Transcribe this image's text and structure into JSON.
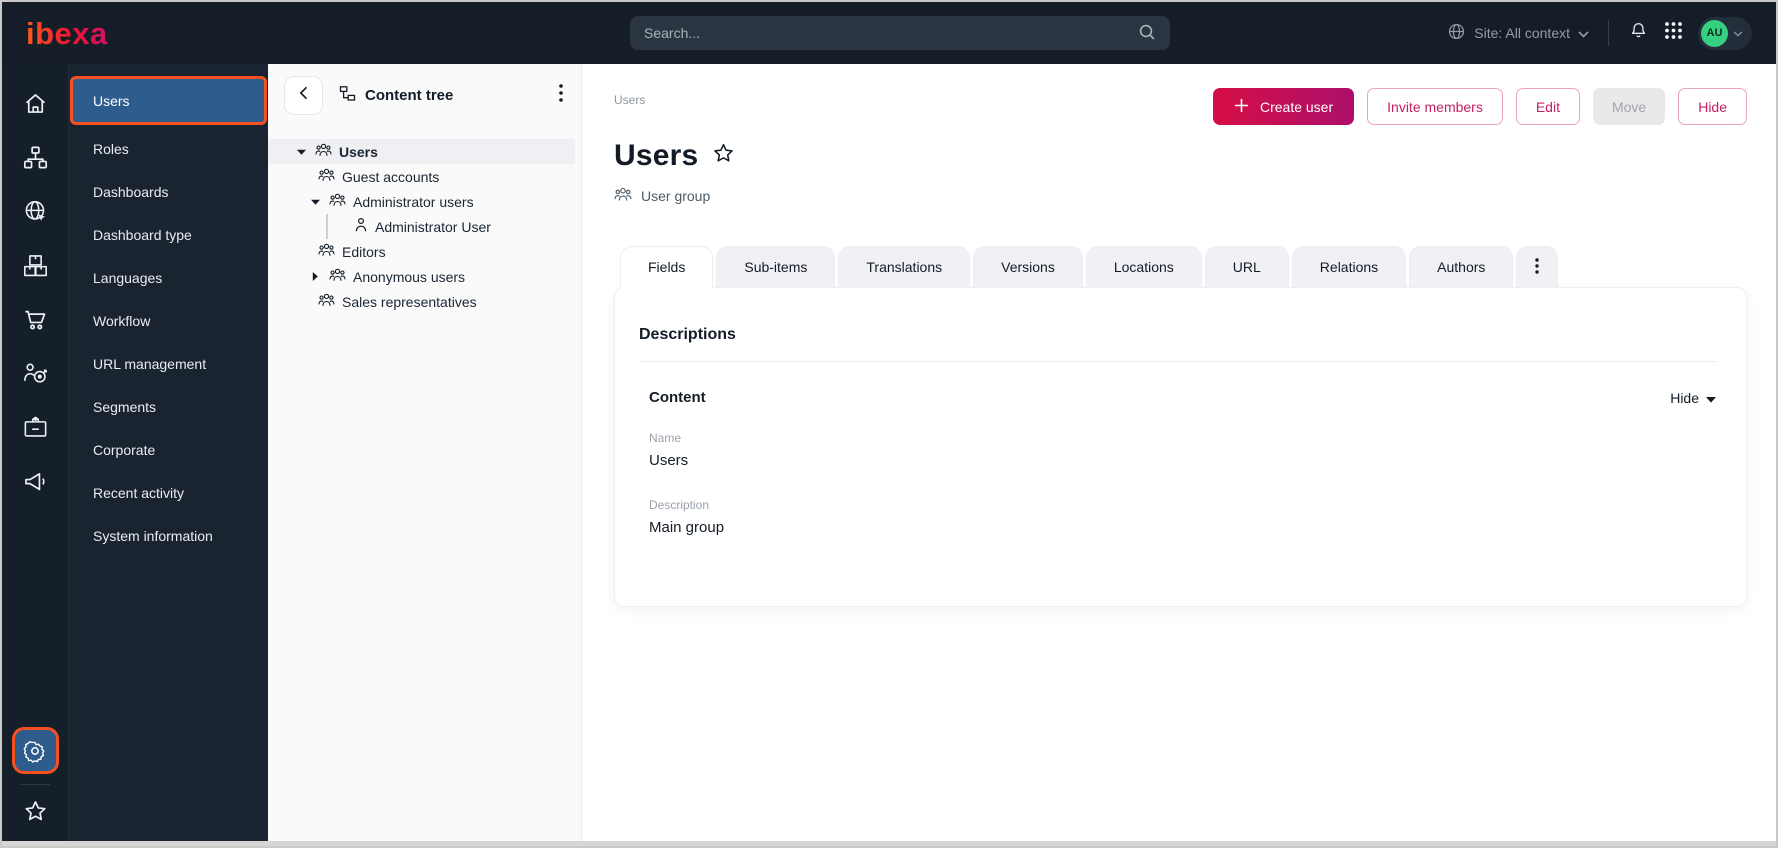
{
  "topbar": {
    "logo": "ibexa",
    "search_placeholder": "Search...",
    "site_context": "Site: All context",
    "avatar_initials": "AU"
  },
  "rail": {
    "top_icons": [
      "home-icon",
      "sitemap-icon",
      "globe-cursor-icon",
      "boxes-icon",
      "cart-icon",
      "target-person-icon",
      "id-badge-icon",
      "megaphone-icon"
    ],
    "bottom_icons": [
      "gear-icon",
      "star-icon"
    ]
  },
  "sidebar": {
    "active_item": "Users",
    "items": [
      "Users",
      "Roles",
      "Dashboards",
      "Dashboard type",
      "Languages",
      "Workflow",
      "URL management",
      "Segments",
      "Corporate",
      "Recent activity",
      "System information"
    ]
  },
  "tree": {
    "title": "Content tree",
    "nodes": [
      {
        "label": "Users",
        "level": 0,
        "caret": "down",
        "icon": "user-group",
        "selected": true
      },
      {
        "label": "Guest accounts",
        "level": 1,
        "caret": "none",
        "icon": "user-group"
      },
      {
        "label": "Administrator users",
        "level": 1,
        "caret": "down",
        "icon": "user-group"
      },
      {
        "label": "Administrator User",
        "level": 2,
        "caret": "none",
        "icon": "user"
      },
      {
        "label": "Editors",
        "level": 1,
        "caret": "none",
        "icon": "user-group"
      },
      {
        "label": "Anonymous users",
        "level": 1,
        "caret": "right",
        "icon": "user-group"
      },
      {
        "label": "Sales representatives",
        "level": 1,
        "caret": "none",
        "icon": "user-group"
      }
    ]
  },
  "main": {
    "breadcrumb": "Users",
    "title": "Users",
    "subtitle": "User group",
    "actions": {
      "create": "Create user",
      "invite": "Invite members",
      "edit": "Edit",
      "move": "Move",
      "hide": "Hide"
    },
    "tabs": [
      "Fields",
      "Sub-items",
      "Translations",
      "Versions",
      "Locations",
      "URL",
      "Relations",
      "Authors"
    ],
    "active_tab": "Fields",
    "card": {
      "heading": "Descriptions",
      "section": "Content",
      "collapse_label": "Hide",
      "fields": [
        {
          "label": "Name",
          "value": "Users"
        },
        {
          "label": "Description",
          "value": "Main group"
        }
      ]
    }
  },
  "colors": {
    "topbar_bg": "#141d28",
    "sidebar_bg": "#1a2430",
    "selected_blue": "#2e5c8d",
    "focus_orange": "#f4511e",
    "primary_gradient_start": "#d60f45",
    "primary_gradient_end": "#ac0f6b",
    "outline_pink": "#c32065",
    "avatar_green": "#35d07f"
  }
}
